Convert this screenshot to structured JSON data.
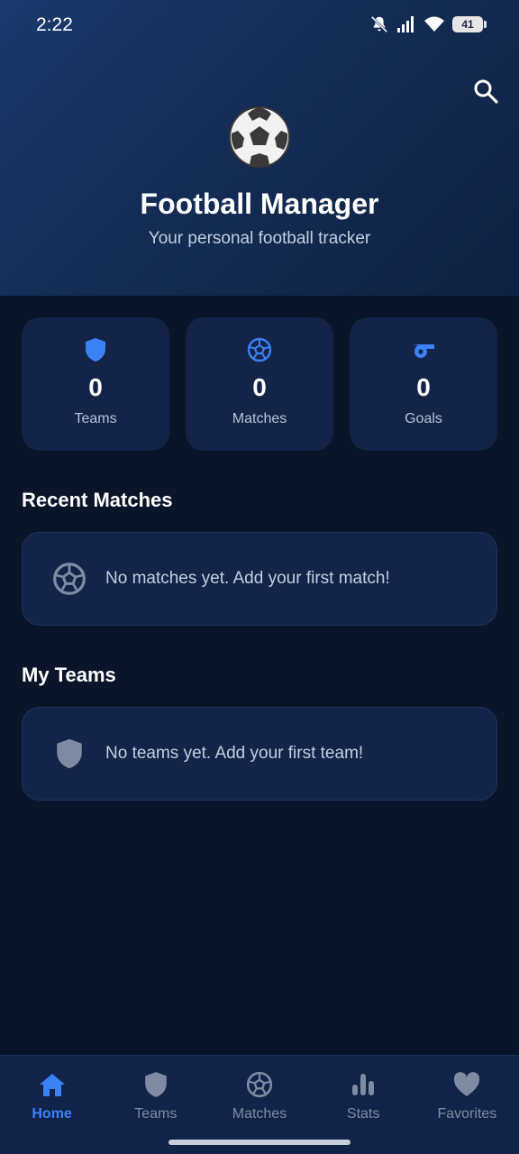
{
  "status_bar": {
    "time": "2:22",
    "battery_level": "41"
  },
  "header": {
    "title": "Football Manager",
    "subtitle": "Your personal football tracker",
    "search_icon": "search-icon",
    "logo_icon": "soccer-ball-icon"
  },
  "stats": [
    {
      "value": "0",
      "label": "Teams",
      "icon": "shield-icon"
    },
    {
      "value": "0",
      "label": "Matches",
      "icon": "soccer-ball-icon"
    },
    {
      "value": "0",
      "label": "Goals",
      "icon": "whistle-icon"
    }
  ],
  "recent_matches": {
    "title": "Recent Matches",
    "empty_message": "No matches yet. Add your first match!"
  },
  "my_teams": {
    "title": "My Teams",
    "empty_message": "No teams yet. Add your first team!"
  },
  "bottom_nav": {
    "items": [
      {
        "label": "Home",
        "icon": "home-icon",
        "active": true
      },
      {
        "label": "Teams",
        "icon": "shield-icon",
        "active": false
      },
      {
        "label": "Matches",
        "icon": "soccer-ball-icon",
        "active": false
      },
      {
        "label": "Stats",
        "icon": "bar-chart-icon",
        "active": false
      },
      {
        "label": "Favorites",
        "icon": "heart-icon",
        "active": false
      }
    ]
  },
  "colors": {
    "background": "#0b1529",
    "card": "#132448",
    "accent": "#3b82f6",
    "inactive": "#7f8ba3",
    "header_gradient_start": "#1a3a6e"
  }
}
